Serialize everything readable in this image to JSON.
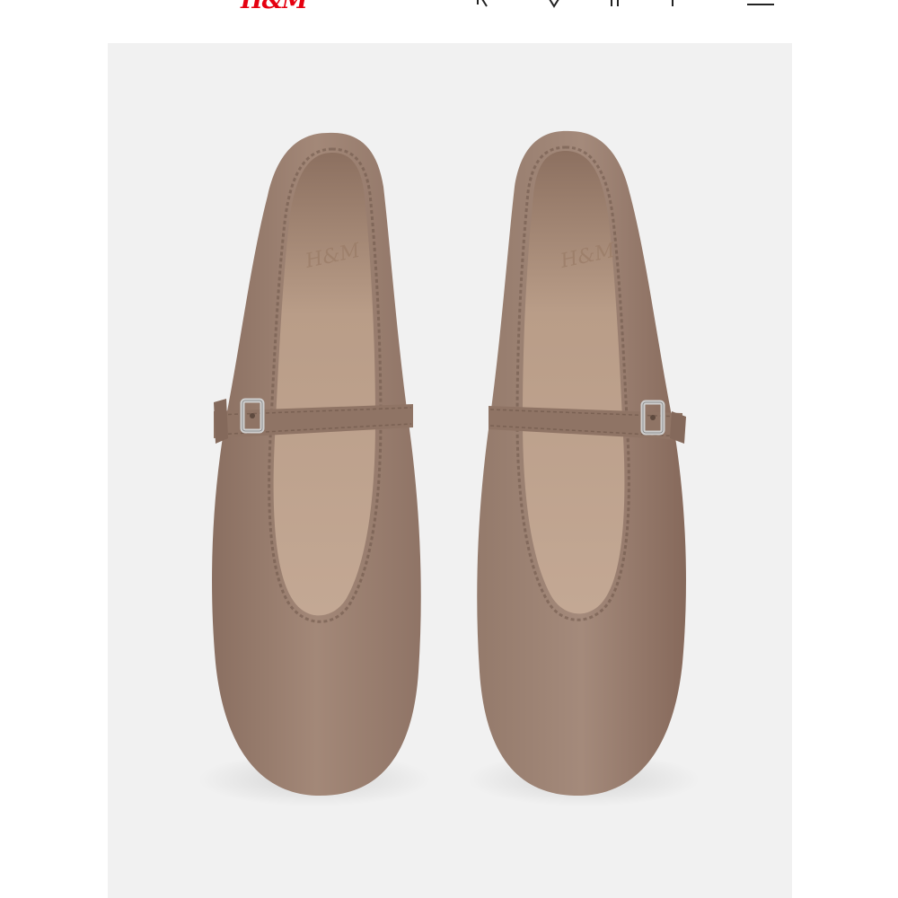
{
  "header": {
    "brand_logo": "H&M",
    "icons": [
      "search-icon",
      "favorites-icon",
      "account-icon",
      "cart-icon",
      "bag-icon"
    ]
  },
  "product": {
    "image_description_icon": "product-photo",
    "colors": {
      "suede": "#9c8172",
      "suede_dark": "#7d6558",
      "lining": "#b79a84",
      "lining_dark": "#8d7262",
      "background": "#f1f1f1",
      "buckle": "#d9d9d9",
      "brand_red": "#e50010"
    }
  }
}
